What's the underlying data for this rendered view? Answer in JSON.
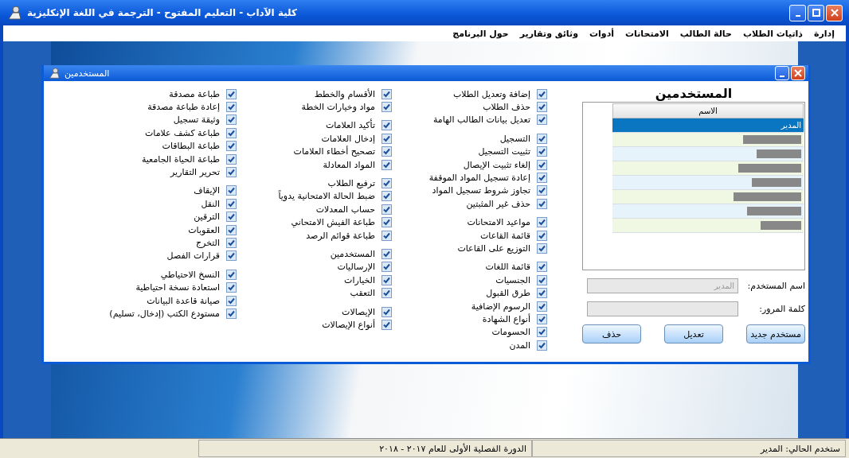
{
  "window": {
    "title": "كلية الآداب - التعليم المفتوح - الترجمة  في اللغة الإنكليزية"
  },
  "menu": [
    "إدارة",
    "ذاتيات الطلاب",
    "حالة الطالب",
    "الامتحانات",
    "أدوات",
    "وثائق وتقارير",
    "حول البرنامج"
  ],
  "dialog": {
    "title": "المستخدمين",
    "heading": "المستخدمين",
    "users": {
      "column": "الاسم",
      "rows": [
        {
          "name": "المدير",
          "redacted": false,
          "selected": true
        },
        {
          "redacted": true,
          "selected": false
        },
        {
          "redacted": true,
          "selected": false
        },
        {
          "redacted": true,
          "selected": false
        },
        {
          "redacted": true,
          "selected": false
        },
        {
          "redacted": true,
          "selected": false
        },
        {
          "redacted": true,
          "selected": false
        },
        {
          "redacted": true,
          "selected": false
        }
      ]
    },
    "fields": [
      {
        "label": "اسم المستخدم:",
        "value": "المدير",
        "disabled": true
      },
      {
        "label": "كلمة المرور:",
        "disabled": true
      }
    ],
    "buttons": [
      "مستخدم جديد",
      "تعديل",
      "حذف"
    ],
    "permission_columns": [
      {
        "groups": [
          [
            {
              "label": "إضافة وتعديل الطلاب",
              "checked": true
            },
            {
              "label": "حذف الطلاب",
              "checked": true
            },
            {
              "label": "تعديل بيانات الطالب الهامة",
              "checked": true
            }
          ],
          [
            {
              "label": "التسجيل",
              "checked": true
            },
            {
              "label": "تثبيت التسجيل",
              "checked": true
            },
            {
              "label": "إلغاء تثبيت الإيصال",
              "checked": true
            },
            {
              "label": "إعادة تسجيل المواد الموقفة",
              "checked": true
            },
            {
              "label": "تجاوز شروط تسجيل المواد",
              "checked": true
            },
            {
              "label": "حذف غير المثبتين",
              "checked": true
            }
          ],
          [
            {
              "label": "مواعيد الامتحانات",
              "checked": true
            },
            {
              "label": "قائمة القاعات",
              "checked": true
            },
            {
              "label": "التوزيع على القاعات",
              "checked": true
            }
          ],
          [
            {
              "label": "قائمة اللغات",
              "checked": true
            },
            {
              "label": "الجنسيات",
              "checked": true
            },
            {
              "label": "طرق القبول",
              "checked": true
            },
            {
              "label": "الرسوم الإضافية",
              "checked": true
            },
            {
              "label": "أنواع الشهادة",
              "checked": true
            },
            {
              "label": "الحسومات",
              "checked": true
            },
            {
              "label": "المدن",
              "checked": true
            }
          ]
        ]
      },
      {
        "groups": [
          [
            {
              "label": "الأقسام والخطط",
              "checked": true
            },
            {
              "label": "مواد وخيارات الخطة",
              "checked": true
            }
          ],
          [
            {
              "label": "تأكيد العلامات",
              "checked": true
            },
            {
              "label": "إدخال العلامات",
              "checked": true
            },
            {
              "label": "تصحيح أخطاء العلامات",
              "checked": true
            },
            {
              "label": "المواد المعادلة",
              "checked": true
            }
          ],
          [
            {
              "label": "ترفيع الطلاب",
              "checked": true
            },
            {
              "label": "ضبط الحالة الامتحانية يدوياً",
              "checked": true
            },
            {
              "label": "حساب المعدلات",
              "checked": true
            },
            {
              "label": "طباعة الفيش الامتحاني",
              "checked": true
            },
            {
              "label": "طباعة قوائم الرصد",
              "checked": true
            }
          ],
          [
            {
              "label": "المستخدمين",
              "checked": true
            },
            {
              "label": "الإرساليات",
              "checked": true
            },
            {
              "label": "الخيارات",
              "checked": true
            },
            {
              "label": "التعقب",
              "checked": true
            }
          ],
          [
            {
              "label": "الإيصالات",
              "checked": true
            },
            {
              "label": "أنواع الإيصالات",
              "checked": true
            }
          ]
        ]
      },
      {
        "groups": [
          [
            {
              "label": "طباعة مصدقة",
              "checked": true
            },
            {
              "label": "إعادة طباعة مصدقة",
              "checked": true
            },
            {
              "label": "وثيقة تسجيل",
              "checked": true
            },
            {
              "label": "طباعة كشف علامات",
              "checked": true
            },
            {
              "label": "طباعة البطاقات",
              "checked": true
            },
            {
              "label": "طباعة الحياة الجامعية",
              "checked": true
            },
            {
              "label": "تحرير التقارير",
              "checked": true
            }
          ],
          [
            {
              "label": "الإيقاف",
              "checked": true
            },
            {
              "label": "النقل",
              "checked": true
            },
            {
              "label": "الترقين",
              "checked": true
            },
            {
              "label": "العقوبات",
              "checked": true
            },
            {
              "label": "التخرج",
              "checked": true
            },
            {
              "label": "قرارات الفصل",
              "checked": true
            }
          ],
          [
            {
              "label": "النسخ الاحتياطي",
              "checked": true
            },
            {
              "label": "استعادة نسخة احتياطية",
              "checked": true
            },
            {
              "label": "صيانة قاعدة البيانات",
              "checked": true
            },
            {
              "label": "مستودع الكتب (إدخال، تسليم)",
              "checked": true
            }
          ]
        ]
      }
    ]
  },
  "status_bar": [
    "ستخدم الحالي: المدير",
    "الدورة الفصلية الأولى للعام ٢٠١٧ - ٢٠١٨"
  ]
}
